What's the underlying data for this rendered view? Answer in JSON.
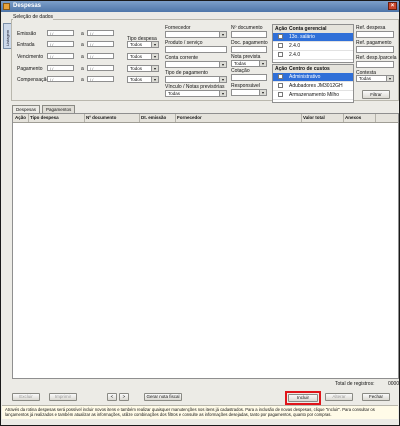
{
  "window": {
    "title": "Despesas"
  },
  "side_tab": {
    "label": "Listagem"
  },
  "filters": {
    "section_title": "Seleção de dados",
    "date_placeholder": "/ /",
    "between": "a",
    "rows": [
      {
        "label": "Emissão",
        "combo": ""
      },
      {
        "label": "Entrada",
        "combo": "Todos"
      },
      {
        "label": "Vencimento",
        "combo": "Todos"
      },
      {
        "label": "Pagamento",
        "combo": "Todos"
      },
      {
        "label": "Compensação",
        "combo": "Todos"
      }
    ],
    "tipo_despesa_label": "Tipo despesa",
    "fornecedor_label": "Fornecedor",
    "produto_servico_label": "Produto / serviço",
    "conta_corrente_label": "Conta corrente",
    "tipo_pagamento_label": "Tipo de pagamento",
    "vinculo_label": "Vínculo / Notas previsórias",
    "vinculo_value": "Todas",
    "n_documento_label": "Nº documento",
    "doc_pagamento_label": "Doc. pagamento",
    "nota_prevista_label": "Nota prevista",
    "nota_prevista_value": "Todas",
    "cotacao_label": "Cotação",
    "responsavel_label": "Responsável",
    "conta_gerencial": {
      "header_acao": "Ação",
      "header_name": "Conta gerencial",
      "rows": [
        "13o. salário",
        "2.4.0",
        "2.4.0"
      ]
    },
    "centro_custos": {
      "header_acao": "Ação",
      "header_name": "Centro de custos",
      "rows": [
        "Administrativo",
        "Adubadores JM3012GH",
        "Armazenamento Milho"
      ]
    },
    "ref_despesa_label": "Ref. despesa",
    "ref_pagamento_label": "Ref. pagamento",
    "ref_desp_parcela_label": "Ref. desp./parcela",
    "contesta_label": "Contesta",
    "contesta_value": "Todas",
    "filtrar_button": "Filtrar"
  },
  "tabs": [
    "Despesas",
    "Pagamentos"
  ],
  "table": {
    "columns": [
      "Ação",
      "Tipo despesa",
      "Nº documento",
      "Dt. emissão",
      "Fornecedor",
      "Valor total",
      "Anexos"
    ]
  },
  "footer": {
    "total_label": "Total de registros:",
    "total_value": "0000",
    "buttons": {
      "excluir": "Excluir",
      "imprimir": "Imprimir",
      "prev": "<",
      "next": ">",
      "gerar_nota": "Gerar nota fiscal",
      "incluir": "Incluir",
      "alterar": "Alterar",
      "fechar": "Fechar"
    },
    "help_text": "Através da rotina despesas será possível incluir novos itens e também realizar quaisquer manutenções nos itens já cadastrados. Para a inclusão de novas despesas, clique \"Incluir\". Para consultar os lançamentos já realizados e também atualizar as informações, utilize combinações dos filtros e consulte as informações desejadas, tanto por pagamentos, quanto por compras."
  },
  "colors": {
    "title_bar": "#4f76a8",
    "selected_row": "#2f6fd8",
    "highlight": "#e0151a"
  }
}
